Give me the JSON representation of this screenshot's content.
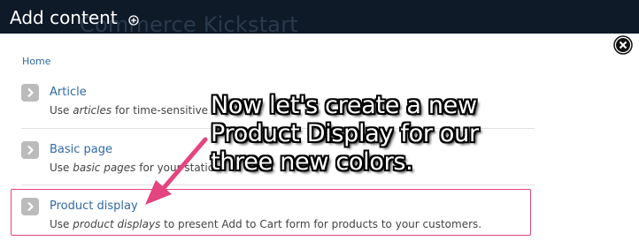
{
  "header": {
    "title": "Add content",
    "background_brand": "Commerce Kickstart",
    "add_icon": "plus-circle-icon"
  },
  "close_icon": "close-circle-icon",
  "breadcrumb": "Home",
  "items": [
    {
      "title": "Article",
      "desc_prefix": "Use ",
      "desc_em": "articles",
      "desc_suffix": " for time-sensitive c"
    },
    {
      "title": "Basic page",
      "desc_prefix": "Use ",
      "desc_em": "basic pages",
      "desc_suffix": " for your static"
    },
    {
      "title": "Product display",
      "desc_prefix": "Use ",
      "desc_em": "product displays",
      "desc_suffix": " to present Add to Cart form for products to your customers."
    }
  ],
  "annotation": {
    "text": "Now let's create a new Product Display for our three new colors.",
    "color": "#e4447f"
  }
}
